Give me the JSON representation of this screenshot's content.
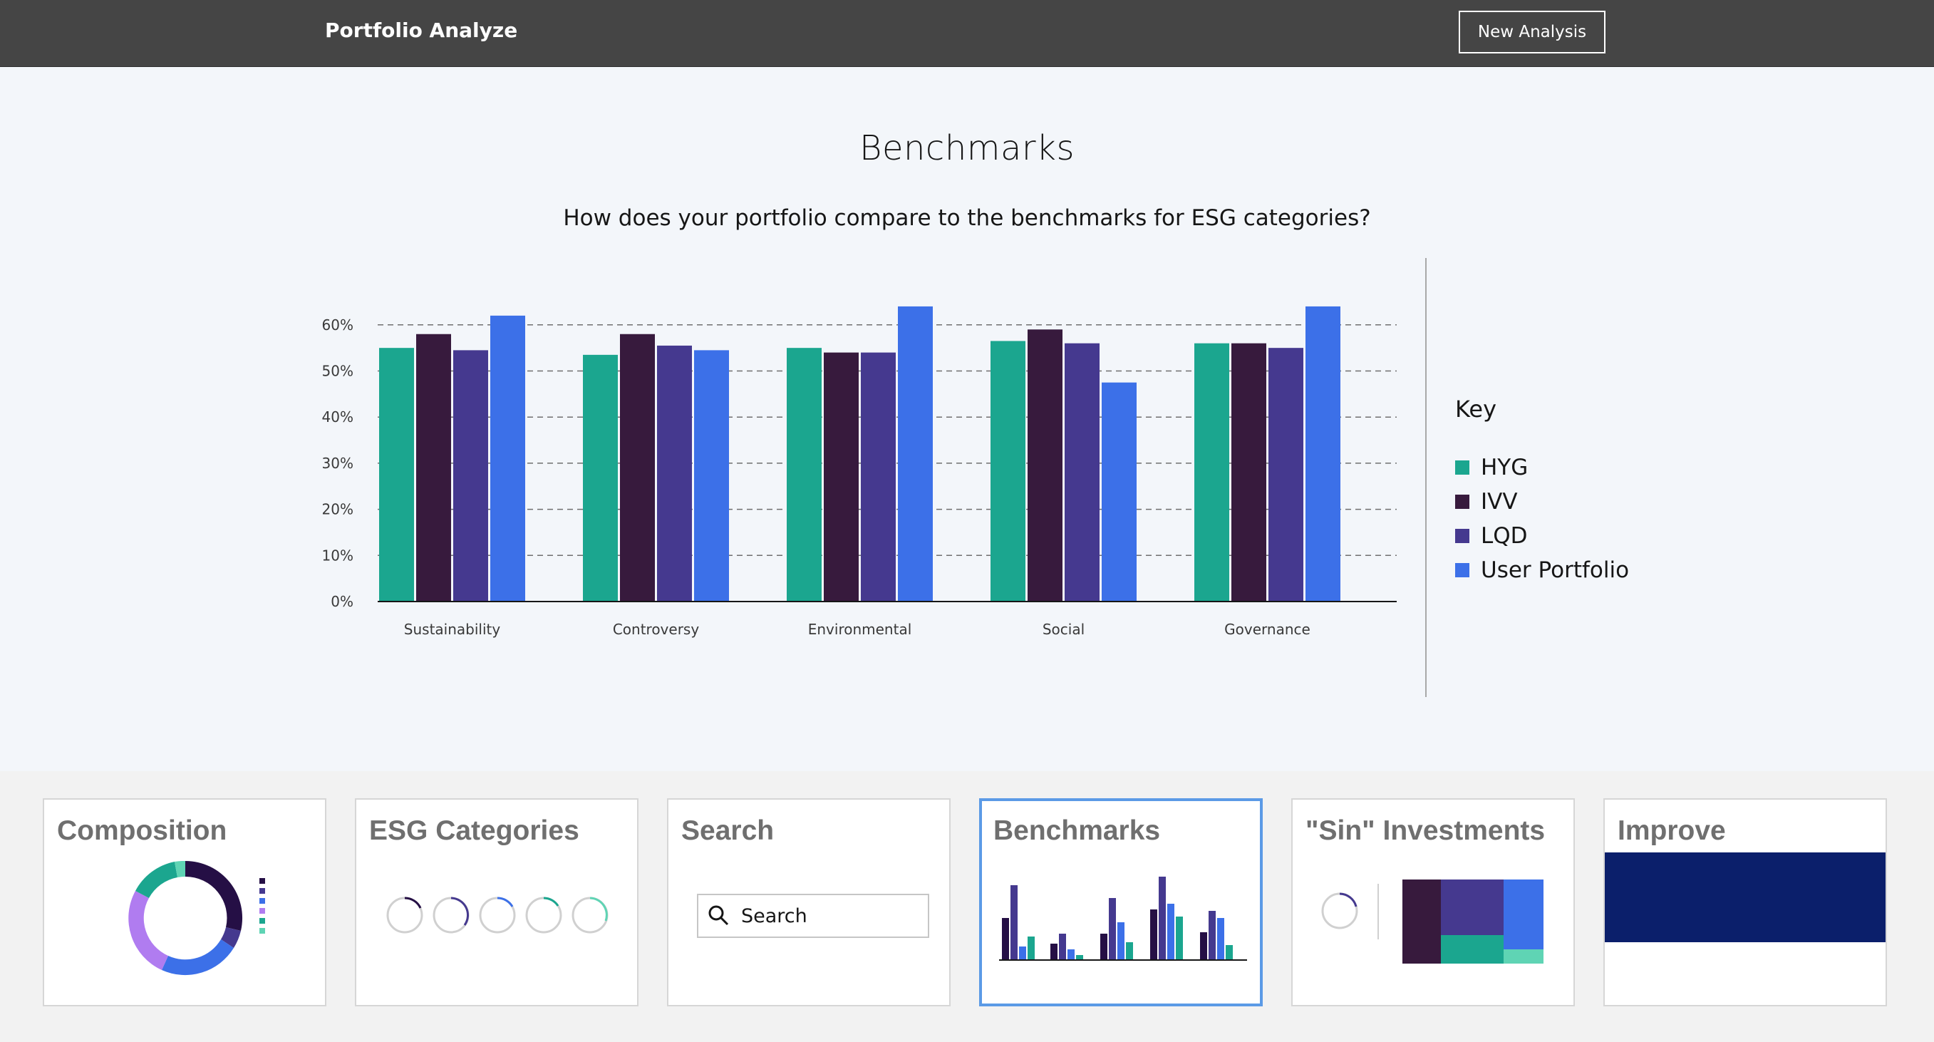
{
  "header": {
    "brand": "Portfolio Analyze",
    "new_analysis_label": "New Analysis"
  },
  "page": {
    "title": "Benchmarks",
    "subtitle": "How does your portfolio compare to the benchmarks for ESG categories?"
  },
  "legend": {
    "title": "Key",
    "items": [
      {
        "label": "HYG",
        "color": "#1ba68f"
      },
      {
        "label": "IVV",
        "color": "#371a3d"
      },
      {
        "label": "LQD",
        "color": "#45398f"
      },
      {
        "label": "User Portfolio",
        "color": "#3c70e8"
      }
    ]
  },
  "chart_data": {
    "type": "bar",
    "categories": [
      "Sustainability",
      "Controversy",
      "Environmental",
      "Social",
      "Governance"
    ],
    "series": [
      {
        "name": "HYG",
        "color": "#1ba68f",
        "values": [
          55,
          53.5,
          55,
          56.5,
          56
        ]
      },
      {
        "name": "IVV",
        "color": "#371a3d",
        "values": [
          58,
          58,
          54,
          59,
          56
        ]
      },
      {
        "name": "LQD",
        "color": "#45398f",
        "values": [
          54.5,
          55.5,
          54,
          56,
          55
        ]
      },
      {
        "name": "User Portfolio",
        "color": "#3c70e8",
        "values": [
          62,
          54.5,
          64,
          47.5,
          64
        ]
      }
    ],
    "ylim": [
      0,
      60
    ],
    "yticks": [
      0,
      10,
      20,
      30,
      40,
      50,
      60
    ],
    "ytick_labels": [
      "0%",
      "10%",
      "20%",
      "30%",
      "40%",
      "50%",
      "60%"
    ],
    "grid": true,
    "legend_position": "right"
  },
  "cards": {
    "composition": {
      "title": "Composition"
    },
    "esg": {
      "title": "ESG Categories"
    },
    "search": {
      "title": "Search",
      "placeholder": "Search"
    },
    "benchmarks": {
      "title": "Benchmarks"
    },
    "sin": {
      "title": "\"Sin\" Investments"
    },
    "improve": {
      "title": "Improve"
    }
  },
  "icons": {
    "search": "search-icon"
  }
}
